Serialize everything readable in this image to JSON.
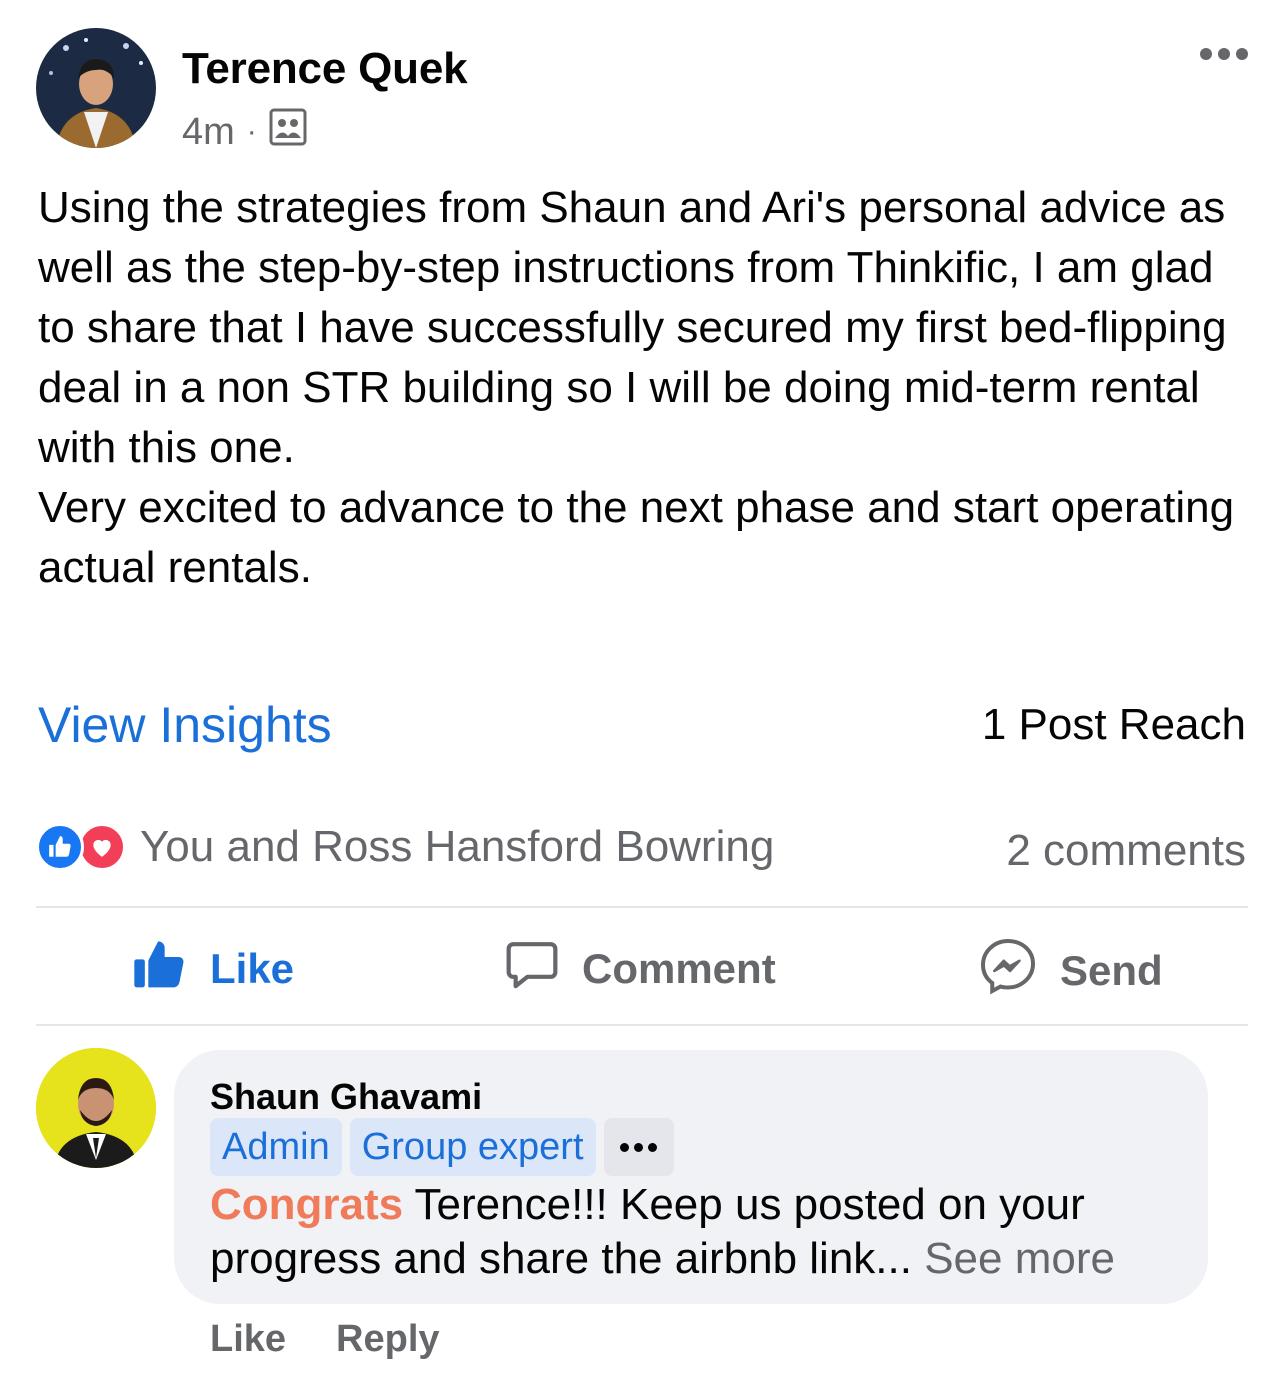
{
  "post": {
    "author": "Terence Quek",
    "time": "4m",
    "separator": "·",
    "audience_icon": "group-audience-icon",
    "body_paragraphs": [
      "Using the strategies from Shaun and Ari's personal advice as well as the step-by-step instructions from Thinkific, I am glad to share that I have successfully secured my first bed-flipping deal in a non STR building so I will be doing mid-term rental with this one.",
      "Very excited to advance to the next phase and start operating actual rentals."
    ],
    "insights_label": "View Insights",
    "reach": "1 Post Reach",
    "reactions_text": "You and Ross Hansford Bowring",
    "comments_count": "2 comments"
  },
  "actions": {
    "like": "Like",
    "comment": "Comment",
    "send": "Send"
  },
  "comment": {
    "author": "Shaun Ghavami",
    "badges": [
      "Admin",
      "Group expert"
    ],
    "highlight": "Congrats",
    "text": " Terence!!! Keep us posted on your progress and share the airbnb link...",
    "see_more": "See more",
    "like_label": "Like",
    "reply_label": "Reply"
  },
  "colors": {
    "link_blue": "#1b6fd8",
    "secondary_text": "#65676b",
    "bubble_bg": "#f0f2f5",
    "highlight": "#f07b5a"
  }
}
